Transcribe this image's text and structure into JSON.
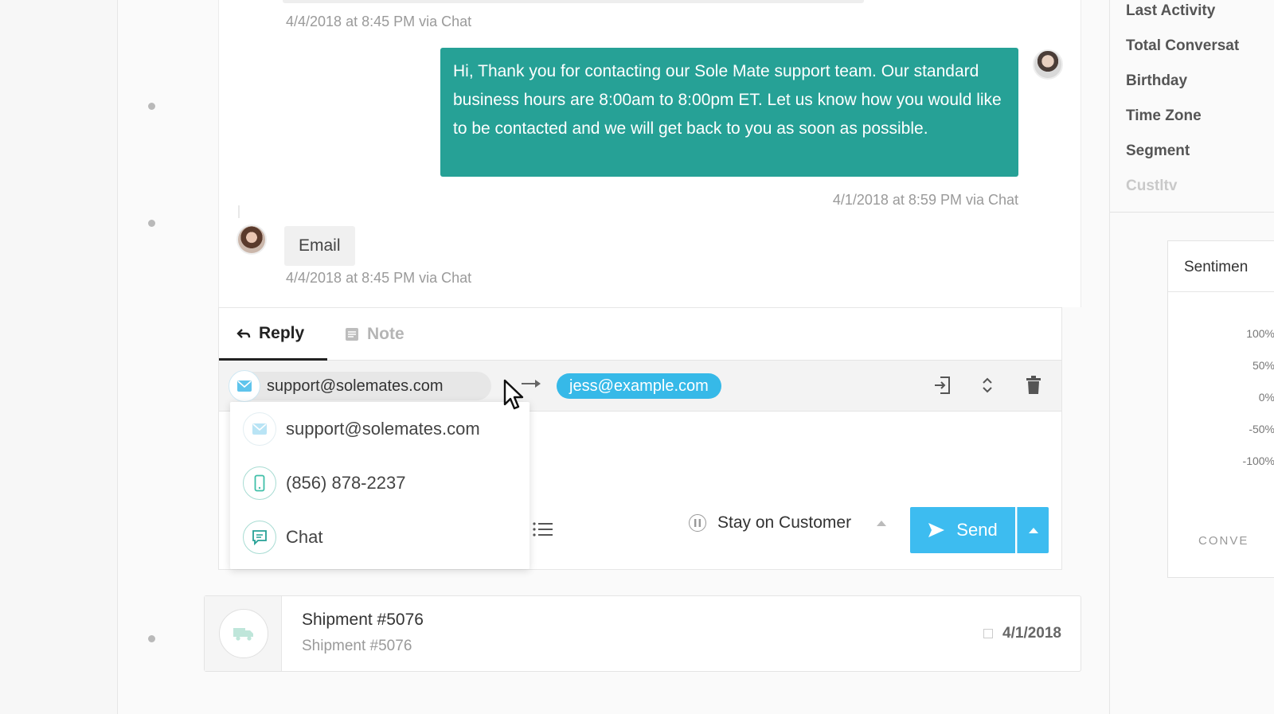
{
  "conversation": {
    "timestamp_top": "4/4/2018 at 8:45 PM via Chat",
    "agent_message": "Hi, Thank you for contacting our Sole Mate support team. Our standard business hours are 8:00am to 8:00pm ET. Let us know how you would like to be contacted and we will get back to you as soon as possible.",
    "agent_timestamp": "4/1/2018 at 8:59 PM via Chat",
    "customer_message": "Email",
    "customer_timestamp": "4/4/2018 at 8:45 PM via Chat"
  },
  "composer": {
    "tabs": {
      "reply": "Reply",
      "note": "Note"
    },
    "from_address": "support@solemates.com",
    "to_address": "jess@example.com",
    "channel_options": [
      {
        "label": "support@solemates.com",
        "icon": "email-icon"
      },
      {
        "label": "(856) 878-2237",
        "icon": "phone-icon"
      },
      {
        "label": "Chat",
        "icon": "chat-icon"
      }
    ],
    "stay_label": "Stay on Customer",
    "send_label": "Send"
  },
  "shipment": {
    "title": "Shipment #5076",
    "subtitle": "Shipment #5076",
    "date": "4/1/2018"
  },
  "customer_panel": {
    "fields": [
      "Last Activity",
      "Total Conversat",
      "Birthday",
      "Time Zone",
      "Segment",
      "Custltv"
    ],
    "sentiment": {
      "title": "Sentimen",
      "ticks": [
        "100%",
        "50%",
        "0%",
        "-50%",
        "-100%"
      ],
      "footer": "CONVE"
    }
  },
  "colors": {
    "agent_bubble": "#26a196",
    "accent_blue": "#3dbcf0",
    "to_pill": "#36b9e8"
  }
}
